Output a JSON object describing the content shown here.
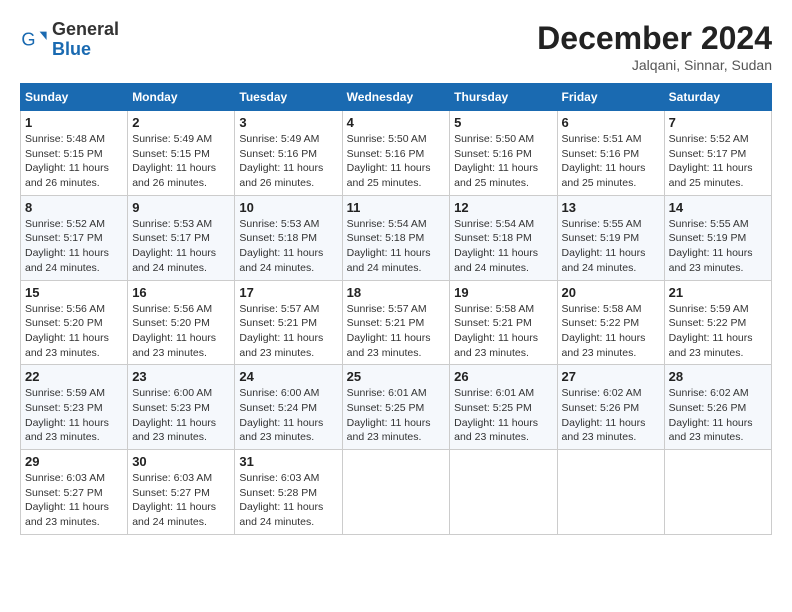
{
  "header": {
    "logo": {
      "general": "General",
      "blue": "Blue"
    },
    "month_title": "December 2024",
    "location": "Jalqani, Sinnar, Sudan"
  },
  "calendar": {
    "days_of_week": [
      "Sunday",
      "Monday",
      "Tuesday",
      "Wednesday",
      "Thursday",
      "Friday",
      "Saturday"
    ],
    "weeks": [
      [
        {
          "day": "1",
          "sunrise": "5:48 AM",
          "sunset": "5:15 PM",
          "daylight": "11 hours and 26 minutes."
        },
        {
          "day": "2",
          "sunrise": "5:49 AM",
          "sunset": "5:15 PM",
          "daylight": "11 hours and 26 minutes."
        },
        {
          "day": "3",
          "sunrise": "5:49 AM",
          "sunset": "5:16 PM",
          "daylight": "11 hours and 26 minutes."
        },
        {
          "day": "4",
          "sunrise": "5:50 AM",
          "sunset": "5:16 PM",
          "daylight": "11 hours and 25 minutes."
        },
        {
          "day": "5",
          "sunrise": "5:50 AM",
          "sunset": "5:16 PM",
          "daylight": "11 hours and 25 minutes."
        },
        {
          "day": "6",
          "sunrise": "5:51 AM",
          "sunset": "5:16 PM",
          "daylight": "11 hours and 25 minutes."
        },
        {
          "day": "7",
          "sunrise": "5:52 AM",
          "sunset": "5:17 PM",
          "daylight": "11 hours and 25 minutes."
        }
      ],
      [
        {
          "day": "8",
          "sunrise": "5:52 AM",
          "sunset": "5:17 PM",
          "daylight": "11 hours and 24 minutes."
        },
        {
          "day": "9",
          "sunrise": "5:53 AM",
          "sunset": "5:17 PM",
          "daylight": "11 hours and 24 minutes."
        },
        {
          "day": "10",
          "sunrise": "5:53 AM",
          "sunset": "5:18 PM",
          "daylight": "11 hours and 24 minutes."
        },
        {
          "day": "11",
          "sunrise": "5:54 AM",
          "sunset": "5:18 PM",
          "daylight": "11 hours and 24 minutes."
        },
        {
          "day": "12",
          "sunrise": "5:54 AM",
          "sunset": "5:18 PM",
          "daylight": "11 hours and 24 minutes."
        },
        {
          "day": "13",
          "sunrise": "5:55 AM",
          "sunset": "5:19 PM",
          "daylight": "11 hours and 24 minutes."
        },
        {
          "day": "14",
          "sunrise": "5:55 AM",
          "sunset": "5:19 PM",
          "daylight": "11 hours and 23 minutes."
        }
      ],
      [
        {
          "day": "15",
          "sunrise": "5:56 AM",
          "sunset": "5:20 PM",
          "daylight": "11 hours and 23 minutes."
        },
        {
          "day": "16",
          "sunrise": "5:56 AM",
          "sunset": "5:20 PM",
          "daylight": "11 hours and 23 minutes."
        },
        {
          "day": "17",
          "sunrise": "5:57 AM",
          "sunset": "5:21 PM",
          "daylight": "11 hours and 23 minutes."
        },
        {
          "day": "18",
          "sunrise": "5:57 AM",
          "sunset": "5:21 PM",
          "daylight": "11 hours and 23 minutes."
        },
        {
          "day": "19",
          "sunrise": "5:58 AM",
          "sunset": "5:21 PM",
          "daylight": "11 hours and 23 minutes."
        },
        {
          "day": "20",
          "sunrise": "5:58 AM",
          "sunset": "5:22 PM",
          "daylight": "11 hours and 23 minutes."
        },
        {
          "day": "21",
          "sunrise": "5:59 AM",
          "sunset": "5:22 PM",
          "daylight": "11 hours and 23 minutes."
        }
      ],
      [
        {
          "day": "22",
          "sunrise": "5:59 AM",
          "sunset": "5:23 PM",
          "daylight": "11 hours and 23 minutes."
        },
        {
          "day": "23",
          "sunrise": "6:00 AM",
          "sunset": "5:23 PM",
          "daylight": "11 hours and 23 minutes."
        },
        {
          "day": "24",
          "sunrise": "6:00 AM",
          "sunset": "5:24 PM",
          "daylight": "11 hours and 23 minutes."
        },
        {
          "day": "25",
          "sunrise": "6:01 AM",
          "sunset": "5:25 PM",
          "daylight": "11 hours and 23 minutes."
        },
        {
          "day": "26",
          "sunrise": "6:01 AM",
          "sunset": "5:25 PM",
          "daylight": "11 hours and 23 minutes."
        },
        {
          "day": "27",
          "sunrise": "6:02 AM",
          "sunset": "5:26 PM",
          "daylight": "11 hours and 23 minutes."
        },
        {
          "day": "28",
          "sunrise": "6:02 AM",
          "sunset": "5:26 PM",
          "daylight": "11 hours and 23 minutes."
        }
      ],
      [
        {
          "day": "29",
          "sunrise": "6:03 AM",
          "sunset": "5:27 PM",
          "daylight": "11 hours and 23 minutes."
        },
        {
          "day": "30",
          "sunrise": "6:03 AM",
          "sunset": "5:27 PM",
          "daylight": "11 hours and 24 minutes."
        },
        {
          "day": "31",
          "sunrise": "6:03 AM",
          "sunset": "5:28 PM",
          "daylight": "11 hours and 24 minutes."
        },
        null,
        null,
        null,
        null
      ]
    ]
  }
}
